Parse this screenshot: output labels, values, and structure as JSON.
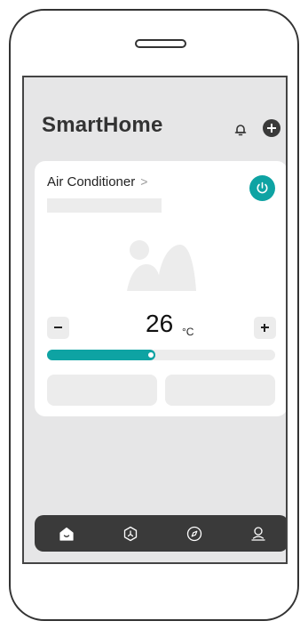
{
  "app": {
    "title": "SmartHome"
  },
  "header": {
    "notifications_icon": "bell-icon",
    "add_icon": "plus-circle-icon"
  },
  "device_card": {
    "title": "Air Conditioner",
    "chevron": ">",
    "power_icon": "power-icon",
    "image_icon": "image-placeholder-icon",
    "temperature": {
      "value": "26",
      "unit": "°C",
      "decrease_icon": "minus-icon",
      "increase_icon": "plus-icon"
    },
    "slider": {
      "level_percent": 45
    }
  },
  "bottom_nav": {
    "items": [
      {
        "icon": "home-icon",
        "active": true
      },
      {
        "icon": "scenes-icon",
        "active": false
      },
      {
        "icon": "compass-icon",
        "active": false
      },
      {
        "icon": "user-icon",
        "active": false
      }
    ]
  },
  "colors": {
    "accent": "#0ea3a3",
    "screen_bg": "#e6e6e7",
    "card_bg": "#ffffff",
    "nav_bg": "#3a3a3a",
    "placeholder": "#ececec"
  }
}
